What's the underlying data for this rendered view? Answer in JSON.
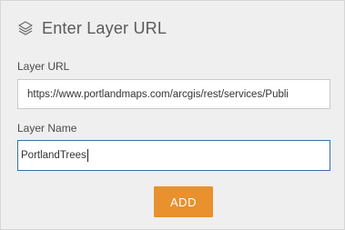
{
  "header": {
    "icon": "layers-icon",
    "title": "Enter Layer URL"
  },
  "layer_url": {
    "label": "Layer URL",
    "value": "https://www.portlandmaps.com/arcgis/rest/services/Publi"
  },
  "layer_name": {
    "label": "Layer Name",
    "value": "PortlandTrees"
  },
  "add_button": {
    "label": "ADD",
    "color": "#e8912d"
  }
}
